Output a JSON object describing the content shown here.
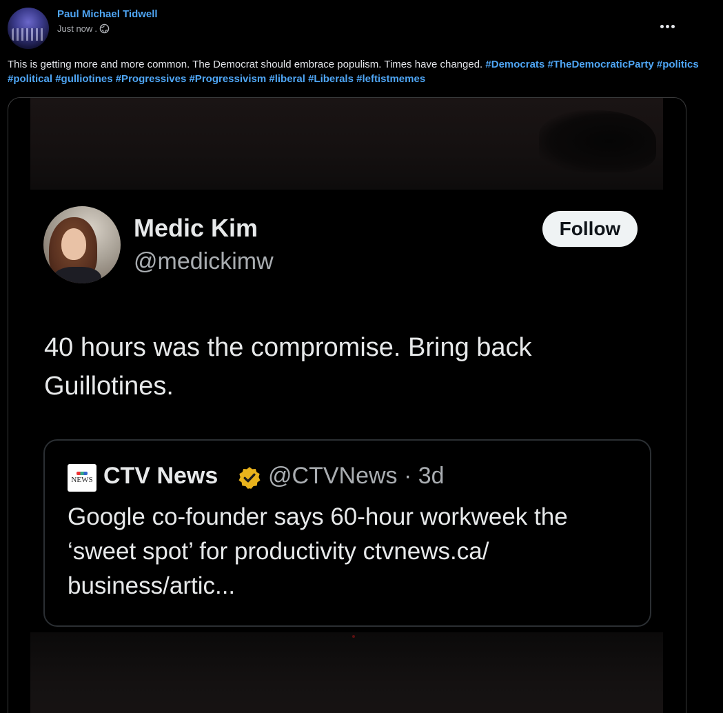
{
  "post": {
    "author": "Paul Michael Tidwell",
    "timestamp": "Just now",
    "separator": ".",
    "privacy_icon": "globe-icon",
    "more_icon": "more-options-icon",
    "caption_text": "This is getting more and more common. The Democrat should embrace populism. Times have changed.",
    "hashtags": [
      "#Democrats",
      "#TheDemocraticParty",
      "#politics",
      "#political",
      "#gulliotines",
      "#Progressives",
      "#Progressivism",
      "#liberal",
      "#Liberals",
      "#leftistmemes"
    ]
  },
  "tweet": {
    "name": "Medic Kim",
    "handle": "@medickimw",
    "follow_label": "Follow",
    "text_line1": "40 hours was the compromise. Bring back",
    "text_line2": "Guillotines."
  },
  "quoted_tweet": {
    "logo_text": "NEWS",
    "name": "CTV News",
    "verified_icon": "verified-badge-icon",
    "handle_time": "@CTVNews · 3d",
    "text_line1": "Google co-founder says 60-hour workweek the",
    "text_line2": "‘sweet spot’ for productivity ctvnews.ca/",
    "text_line3": "business/artic..."
  },
  "colors": {
    "link": "#4fa6f5",
    "background": "#000000",
    "text": "#e4e6eb",
    "verified_gold": "#e8b21c"
  }
}
